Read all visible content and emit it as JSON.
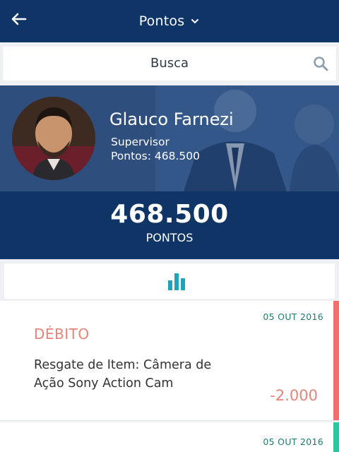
{
  "header": {
    "title": "Pontos",
    "back_icon": "arrow-left-icon",
    "dropdown_icon": "chevron-down-icon"
  },
  "search": {
    "placeholder": "Busca",
    "icon": "search-icon"
  },
  "profile": {
    "name": "Glauco Farnezi",
    "role": "Supervisor",
    "points_line": "Pontos: 468.500"
  },
  "summary": {
    "points": "468.500",
    "label": "PONTOS"
  },
  "chart_toggle": {
    "icon": "bar-chart-icon"
  },
  "entries": [
    {
      "date": "05 OUT 2016",
      "type": "DÉBITO",
      "description": "Resgate de Item: Câmera de Ação Sony Action Cam",
      "amount": "-2.000",
      "stripe_color": "#f07070"
    },
    {
      "date": "05 OUT 2016",
      "stripe_color": "#2fc4a0"
    }
  ],
  "colors": {
    "primary": "#0f3466",
    "accent": "#1fa3b8",
    "debit": "#e8837a",
    "credit": "#2fc4a0"
  }
}
